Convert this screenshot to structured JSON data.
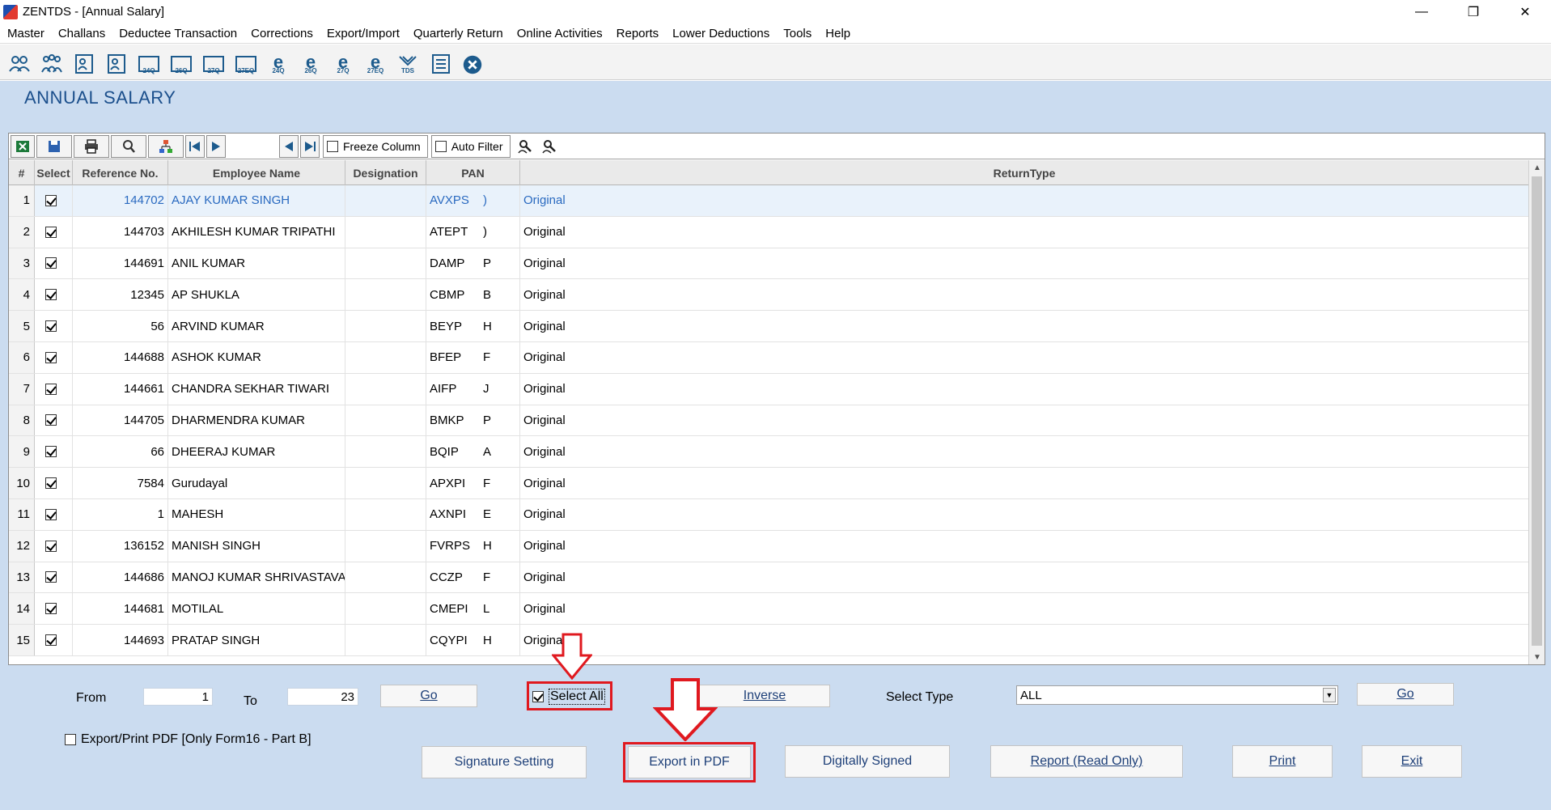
{
  "window": {
    "title": "ZENTDS - [Annual Salary]",
    "controls": [
      "—",
      "❐",
      "✕"
    ]
  },
  "menu": [
    "Master",
    "Challans",
    "Deductee Transaction",
    "Corrections",
    "Export/Import",
    "Quarterly Return",
    "Online Activities",
    "Reports",
    "Lower Deductions",
    "Tools",
    "Help"
  ],
  "toolbar_icons": [
    {
      "name": "users-icon",
      "caption": ""
    },
    {
      "name": "group-users-icon",
      "caption": ""
    },
    {
      "name": "person-form-icon",
      "caption": ""
    },
    {
      "name": "person-form-2-icon",
      "caption": ""
    },
    {
      "name": "form-24q-icon",
      "caption": "24Q"
    },
    {
      "name": "form-26q-icon",
      "caption": "26Q"
    },
    {
      "name": "form-27q-icon",
      "caption": "27Q"
    },
    {
      "name": "form-27eq-icon",
      "caption": "27EQ"
    },
    {
      "name": "e-24q-icon",
      "caption": "24Q"
    },
    {
      "name": "e-26q-icon",
      "caption": "26Q"
    },
    {
      "name": "e-27q-icon",
      "caption": "27Q"
    },
    {
      "name": "e-27eq-icon",
      "caption": "27EQ"
    },
    {
      "name": "tds-icon",
      "caption": "TDS"
    },
    {
      "name": "document-list-icon",
      "caption": ""
    },
    {
      "name": "close-circle-icon",
      "caption": ""
    }
  ],
  "page": {
    "title": "ANNUAL SALARY"
  },
  "grid_tools": {
    "freeze_column": "Freeze Column",
    "auto_filter": "Auto Filter"
  },
  "grid": {
    "headers": [
      "#",
      "Select",
      "Reference No.",
      "Employee Name",
      "Designation",
      "PAN",
      "ReturnType"
    ],
    "rows": [
      {
        "n": "1",
        "ref": "144702",
        "name": "AJAY KUMAR SINGH",
        "designation": "",
        "pan": "AVXPS",
        "pan_end": ")",
        "type": "Original"
      },
      {
        "n": "2",
        "ref": "144703",
        "name": "AKHILESH KUMAR TRIPATHI",
        "designation": "",
        "pan": "ATEPT",
        "pan_end": ")",
        "type": "Original"
      },
      {
        "n": "3",
        "ref": "144691",
        "name": "ANIL KUMAR",
        "designation": "",
        "pan": "DAMP",
        "pan_end": "P",
        "type": "Original"
      },
      {
        "n": "4",
        "ref": "12345",
        "name": "AP SHUKLA",
        "designation": "",
        "pan": "CBMP",
        "pan_end": "B",
        "type": "Original"
      },
      {
        "n": "5",
        "ref": "56",
        "name": "ARVIND KUMAR",
        "designation": "",
        "pan": "BEYP",
        "pan_end": "H",
        "type": "Original"
      },
      {
        "n": "6",
        "ref": "144688",
        "name": "ASHOK KUMAR",
        "designation": "",
        "pan": "BFEP",
        "pan_end": "F",
        "type": "Original"
      },
      {
        "n": "7",
        "ref": "144661",
        "name": "CHANDRA SEKHAR TIWARI",
        "designation": "",
        "pan": "AIFP",
        "pan_end": "J",
        "type": "Original"
      },
      {
        "n": "8",
        "ref": "144705",
        "name": "DHARMENDRA KUMAR",
        "designation": "",
        "pan": "BMKP",
        "pan_end": "P",
        "type": "Original"
      },
      {
        "n": "9",
        "ref": "66",
        "name": "DHEERAJ KUMAR",
        "designation": "",
        "pan": "BQIP",
        "pan_end": "A",
        "type": "Original"
      },
      {
        "n": "10",
        "ref": "7584",
        "name": "Gurudayal",
        "designation": "",
        "pan": "APXPI",
        "pan_end": "F",
        "type": "Original"
      },
      {
        "n": "11",
        "ref": "1",
        "name": "MAHESH",
        "designation": "",
        "pan": "AXNPI",
        "pan_end": "E",
        "type": "Original"
      },
      {
        "n": "12",
        "ref": "136152",
        "name": "MANISH SINGH",
        "designation": "",
        "pan": "FVRPS",
        "pan_end": "H",
        "type": "Original"
      },
      {
        "n": "13",
        "ref": "144686",
        "name": "MANOJ KUMAR SHRIVASTAVA",
        "designation": "",
        "pan": "CCZP",
        "pan_end": "F",
        "type": "Original"
      },
      {
        "n": "14",
        "ref": "144681",
        "name": "MOTILAL",
        "designation": "",
        "pan": "CMEPI",
        "pan_end": "L",
        "type": "Original"
      },
      {
        "n": "15",
        "ref": "144693",
        "name": "PRATAP SINGH",
        "designation": "",
        "pan": "CQYPI",
        "pan_end": "H",
        "type": "Original"
      }
    ]
  },
  "bottom": {
    "from_label": "From",
    "from_value": "1",
    "to_label": "To",
    "to_value": "23",
    "go_label": "Go",
    "select_all_label": "Select All",
    "inverse_label": "Inverse",
    "select_type_label": "Select Type",
    "select_type_value": "ALL",
    "go2_label": "Go",
    "export_print_label": "Export/Print PDF [Only Form16 - Part B]",
    "signature_label": "Signature Setting",
    "export_pdf_label": "Export in PDF",
    "digitally_signed_label": "Digitally Signed",
    "report_label": "Report (Read Only)",
    "print_label": "Print",
    "exit_label": "Exit"
  },
  "colors": {
    "main_bg": "#cbdcf0",
    "title_blue": "#1b4f8c",
    "highlight_red": "#e0191f",
    "selected_row_text": "#2a6ac0"
  }
}
